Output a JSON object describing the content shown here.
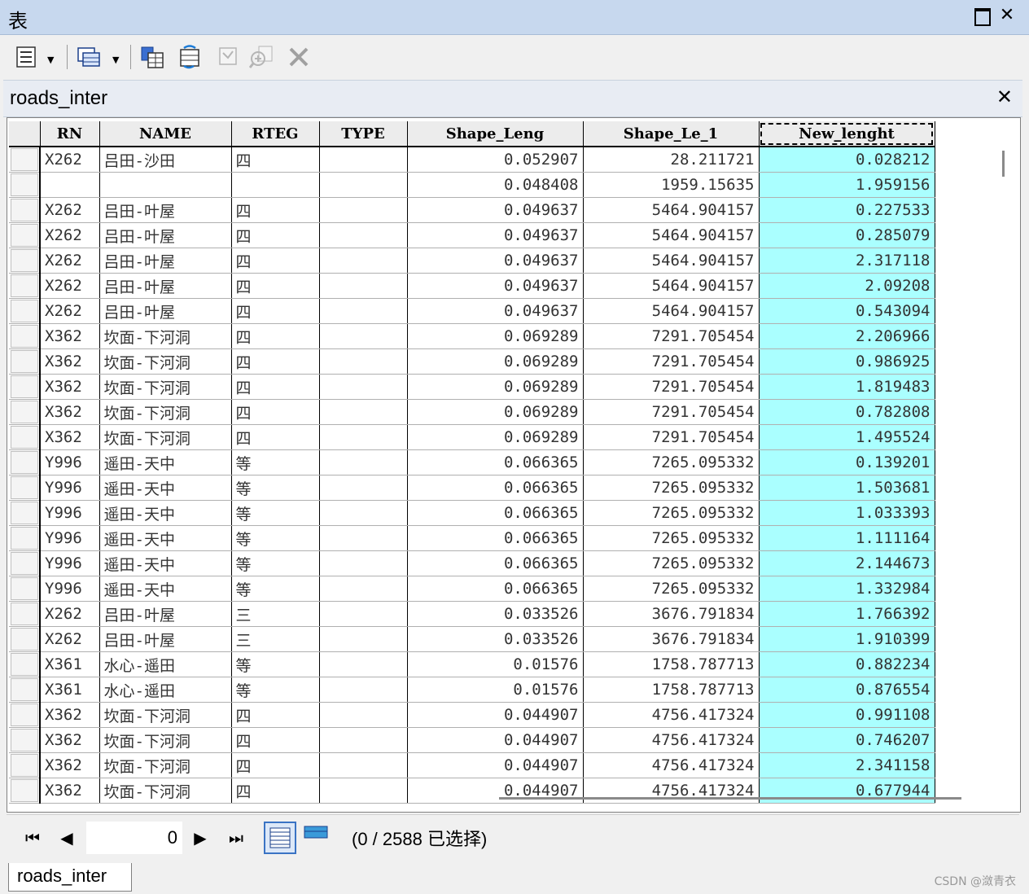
{
  "window": {
    "title": "表"
  },
  "toolbar": {
    "icons": [
      "table-options-icon",
      "related-tables-icon",
      "select-by-attributes-icon",
      "switch-selection-icon",
      "clear-selection-icon",
      "zoom-to-selected-icon",
      "delete-selected-icon"
    ]
  },
  "table_tab": {
    "name": "roads_inter",
    "close": "✕"
  },
  "columns": [
    "RN",
    "NAME",
    "RTEG",
    "TYPE",
    "Shape_Leng",
    "Shape_Le_1",
    "New_lenght"
  ],
  "rows": [
    [
      "X262",
      "吕田-沙田",
      "四",
      "",
      "0.052907",
      "28.211721",
      "0.028212"
    ],
    [
      "",
      "",
      "",
      "",
      "0.048408",
      "1959.15635",
      "1.959156"
    ],
    [
      "X262",
      "吕田-叶屋",
      "四",
      "",
      "0.049637",
      "5464.904157",
      "0.227533"
    ],
    [
      "X262",
      "吕田-叶屋",
      "四",
      "",
      "0.049637",
      "5464.904157",
      "0.285079"
    ],
    [
      "X262",
      "吕田-叶屋",
      "四",
      "",
      "0.049637",
      "5464.904157",
      "2.317118"
    ],
    [
      "X262",
      "吕田-叶屋",
      "四",
      "",
      "0.049637",
      "5464.904157",
      "2.09208"
    ],
    [
      "X262",
      "吕田-叶屋",
      "四",
      "",
      "0.049637",
      "5464.904157",
      "0.543094"
    ],
    [
      "X362",
      "坎面-下河洞",
      "四",
      "",
      "0.069289",
      "7291.705454",
      "2.206966"
    ],
    [
      "X362",
      "坎面-下河洞",
      "四",
      "",
      "0.069289",
      "7291.705454",
      "0.986925"
    ],
    [
      "X362",
      "坎面-下河洞",
      "四",
      "",
      "0.069289",
      "7291.705454",
      "1.819483"
    ],
    [
      "X362",
      "坎面-下河洞",
      "四",
      "",
      "0.069289",
      "7291.705454",
      "0.782808"
    ],
    [
      "X362",
      "坎面-下河洞",
      "四",
      "",
      "0.069289",
      "7291.705454",
      "1.495524"
    ],
    [
      "Y996",
      "遥田-天中",
      "等",
      "",
      "0.066365",
      "7265.095332",
      "0.139201"
    ],
    [
      "Y996",
      "遥田-天中",
      "等",
      "",
      "0.066365",
      "7265.095332",
      "1.503681"
    ],
    [
      "Y996",
      "遥田-天中",
      "等",
      "",
      "0.066365",
      "7265.095332",
      "1.033393"
    ],
    [
      "Y996",
      "遥田-天中",
      "等",
      "",
      "0.066365",
      "7265.095332",
      "1.111164"
    ],
    [
      "Y996",
      "遥田-天中",
      "等",
      "",
      "0.066365",
      "7265.095332",
      "2.144673"
    ],
    [
      "Y996",
      "遥田-天中",
      "等",
      "",
      "0.066365",
      "7265.095332",
      "1.332984"
    ],
    [
      "X262",
      "吕田-叶屋",
      "三",
      "",
      "0.033526",
      "3676.791834",
      "1.766392"
    ],
    [
      "X262",
      "吕田-叶屋",
      "三",
      "",
      "0.033526",
      "3676.791834",
      "1.910399"
    ],
    [
      "X361",
      "水心-遥田",
      "等",
      "",
      "0.01576",
      "1758.787713",
      "0.882234"
    ],
    [
      "X361",
      "水心-遥田",
      "等",
      "",
      "0.01576",
      "1758.787713",
      "0.876554"
    ],
    [
      "X362",
      "坎面-下河洞",
      "四",
      "",
      "0.044907",
      "4756.417324",
      "0.991108"
    ],
    [
      "X362",
      "坎面-下河洞",
      "四",
      "",
      "0.044907",
      "4756.417324",
      "0.746207"
    ],
    [
      "X362",
      "坎面-下河洞",
      "四",
      "",
      "0.044907",
      "4756.417324",
      "2.341158"
    ],
    [
      "X362",
      "坎面-下河洞",
      "四",
      "",
      "0.044907",
      "4756.417324",
      "0.677944"
    ]
  ],
  "navigation": {
    "current_record": "0",
    "status": "(0 / 2588 已选择)"
  },
  "bottom_tab": {
    "name": "roads_inter"
  },
  "watermark": "CSDN @潋青衣",
  "colors": {
    "title_bar": "#c7d8ee",
    "highlight_column": "#aaffff",
    "grid_header": "#ececec"
  }
}
